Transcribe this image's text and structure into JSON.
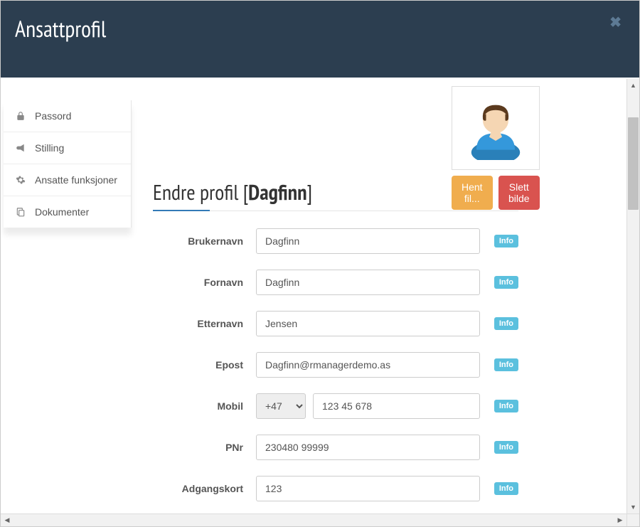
{
  "header": {
    "title": "Ansattprofil"
  },
  "sidebar": {
    "items": [
      {
        "label": "Passord",
        "icon": "lock-icon"
      },
      {
        "label": "Stilling",
        "icon": "bullhorn-icon"
      },
      {
        "label": "Ansatte funksjoner",
        "icon": "gear-icon"
      },
      {
        "label": "Dokumenter",
        "icon": "copy-icon"
      }
    ]
  },
  "profile": {
    "title_prefix": "Endre profil ",
    "name": "Dagfinn",
    "avatar": {
      "get_file_label": "Hent fil...",
      "delete_label": "Slett bilde"
    }
  },
  "form": {
    "info_label": "Info",
    "fields": {
      "username": {
        "label": "Brukernavn",
        "value": "Dagfinn"
      },
      "firstname": {
        "label": "Fornavn",
        "value": "Dagfinn"
      },
      "lastname": {
        "label": "Etternavn",
        "value": "Jensen"
      },
      "email": {
        "label": "Epost",
        "value": "Dagfinn@rmanagerdemo.as"
      },
      "mobile": {
        "label": "Mobil",
        "code": "+47",
        "value": "123 45 678"
      },
      "pnr": {
        "label": "PNr",
        "value": "230480 99999"
      },
      "accesscard": {
        "label": "Adgangskort",
        "value": "123"
      }
    }
  }
}
